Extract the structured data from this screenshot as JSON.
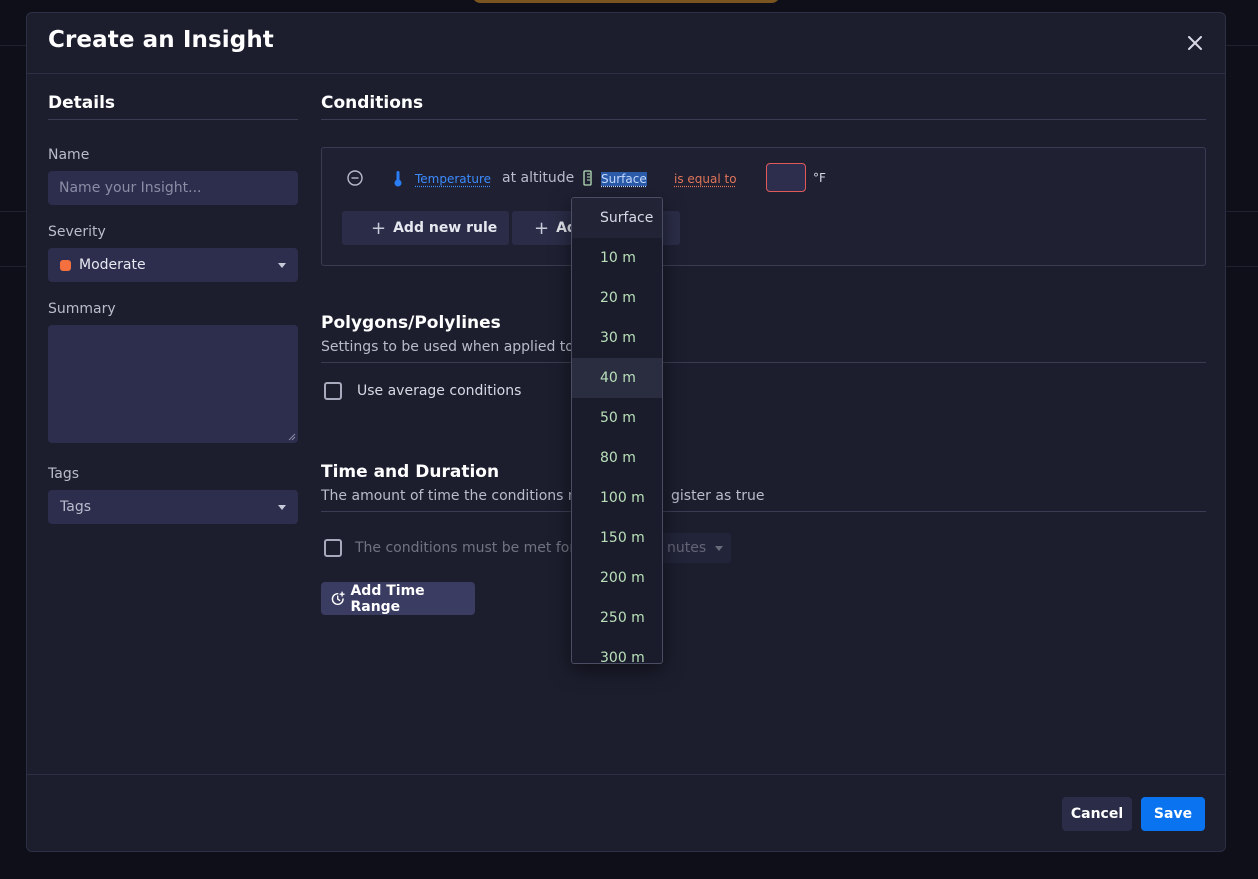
{
  "modal": {
    "title": "Create an Insight"
  },
  "details": {
    "heading": "Details",
    "name_label": "Name",
    "name_placeholder": "Name your Insight...",
    "severity_label": "Severity",
    "severity_value": "Moderate",
    "severity_color": "#f4703f",
    "summary_label": "Summary",
    "tags_label": "Tags",
    "tags_placeholder": "Tags"
  },
  "conditions": {
    "heading": "Conditions",
    "rule": {
      "variable": "Temperature",
      "altitude_text": "at altitude",
      "altitude_value": "Surface",
      "operator": "is equal to",
      "unit": "°F"
    },
    "add_rule_label": "Add new rule",
    "add_group_label": "Ad"
  },
  "polygons": {
    "heading": "Polygons/Polylines",
    "description": "Settings to be used when applied to an",
    "checkbox_label": "Use average conditions"
  },
  "time": {
    "heading": "Time and Duration",
    "description": "The amount of time the conditions mus",
    "description_tail": "gister as true",
    "checkbox_label": "The conditions must be met for at",
    "unit_select": "nutes",
    "add_time_range_label": "Add Time Range"
  },
  "footer": {
    "cancel_label": "Cancel",
    "save_label": "Save"
  },
  "altitude_dropdown": {
    "options": [
      "Surface",
      "10 m",
      "20 m",
      "30 m",
      "40 m",
      "50 m",
      "80 m",
      "100 m",
      "150 m",
      "200 m",
      "250 m",
      "300 m"
    ],
    "selected": "Surface",
    "hovered": "40 m"
  },
  "colors": {
    "accent_blue": "#0a74f0",
    "link_blue": "#3b8bff",
    "operator_red": "#e0745a",
    "severity_moderate": "#f4703f"
  }
}
